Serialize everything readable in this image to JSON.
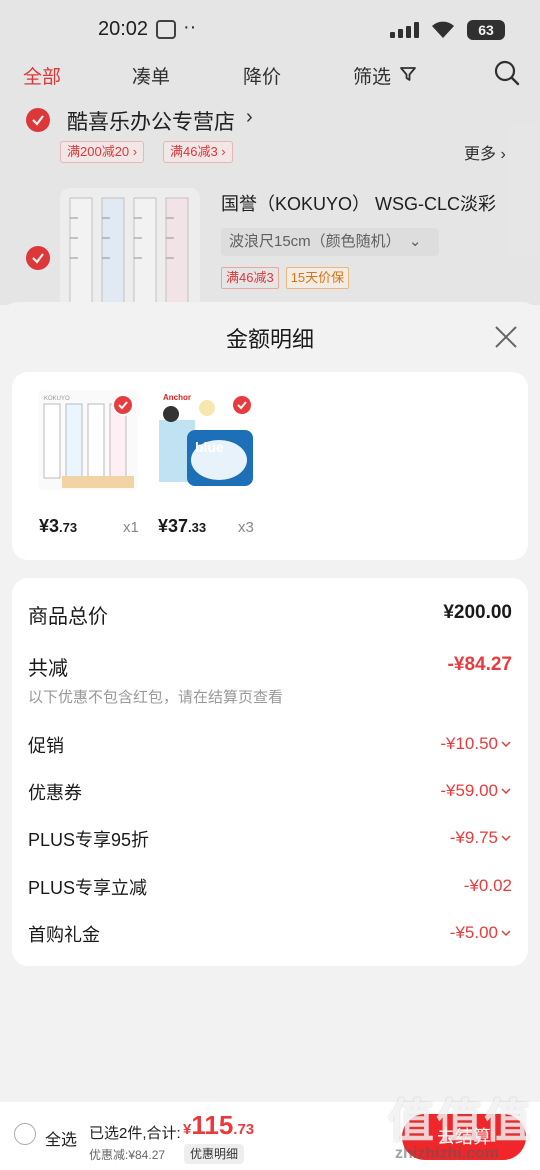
{
  "status_bar": {
    "time": "20:02",
    "dots": "··",
    "battery": "63"
  },
  "tabs": [
    {
      "label": "全部"
    },
    {
      "label": "凑单"
    },
    {
      "label": "降价"
    },
    {
      "label": "筛选"
    }
  ],
  "store": {
    "name": "酷喜乐办公专营店",
    "promos": [
      "满200减20 ›",
      "满46减3 ›"
    ],
    "more": "更多 ›"
  },
  "cart_item": {
    "title": "国誉（KOKUYO） WSG-CLC淡彩",
    "spec": "波浪尺15cm（颜色随机）",
    "tags": [
      "满46减3",
      "15天价保"
    ]
  },
  "sheet": {
    "title": "金额明细",
    "items": [
      {
        "price_int": "¥3",
        "price_dec": ".73",
        "qty": "x1"
      },
      {
        "price_int": "¥37",
        "price_dec": ".33",
        "qty": "x3"
      }
    ],
    "total_label": "商品总价",
    "total_value": "¥200.00",
    "reduce_label": "共减",
    "reduce_value": "-¥84.27",
    "note": "以下优惠不包含红包，请在结算页查看",
    "rows": [
      {
        "label": "促销",
        "value": "-¥10.50"
      },
      {
        "label": "优惠券",
        "value": "-¥59.00"
      },
      {
        "label": "PLUS专享95折",
        "value": "-¥9.75"
      },
      {
        "label": "PLUS专享立减",
        "value": "-¥0.02"
      },
      {
        "label": "首购礼金",
        "value": "-¥5.00"
      }
    ]
  },
  "bottom": {
    "select_all": "全选",
    "selected": "已选2件,合计:",
    "yen": "¥",
    "amount_int": "115",
    "amount_dec": ".73",
    "discount": "优惠减:¥84.27",
    "detail_btn": "优惠明细",
    "checkout": "去结算"
  },
  "watermark": {
    "text": "值值值",
    "url": "zhizhizhi.com"
  },
  "colors": {
    "accent": "#e93b3d",
    "sheet_bg": "#f2f2f2"
  }
}
